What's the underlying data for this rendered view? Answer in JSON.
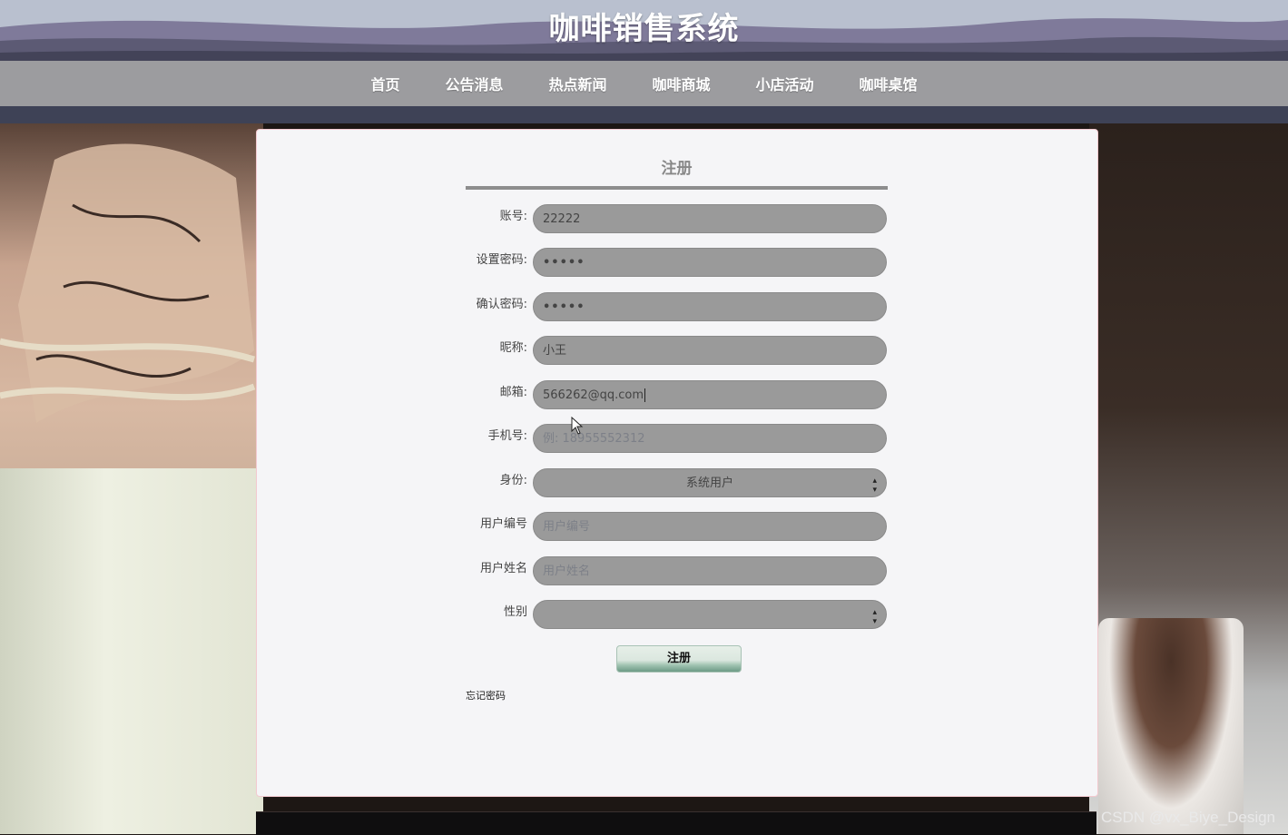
{
  "header": {
    "title": "咖啡销售系统"
  },
  "nav": {
    "items": [
      "首页",
      "公告消息",
      "热点新闻",
      "咖啡商城",
      "小店活动",
      "咖啡桌馆"
    ]
  },
  "form": {
    "title": "注册",
    "fields": [
      {
        "label": "账号:",
        "value": "22222"
      },
      {
        "label": "设置密码:",
        "value": "•••••"
      },
      {
        "label": "确认密码:",
        "value": "•••••"
      },
      {
        "label": "昵称:",
        "value": "小王"
      },
      {
        "label": "邮箱:",
        "value": "566262@qq.com"
      },
      {
        "label": "手机号:",
        "placeholder": "例: 18955552312"
      },
      {
        "label": "身份:",
        "selected": "系统用户"
      },
      {
        "label": "用户编号",
        "placeholder": "用户编号"
      },
      {
        "label": "用户姓名",
        "placeholder": "用户姓名"
      },
      {
        "label": "性别",
        "selected": ""
      }
    ],
    "submit_label": "注册",
    "forgot_label": "忘记密码"
  },
  "watermark": "CSDN @vx_Biye_Design",
  "colors": {
    "panel_bg": "#f5f5f7",
    "field_bg": "#9a9a9a",
    "nav_bg": "#9c9c9f"
  }
}
